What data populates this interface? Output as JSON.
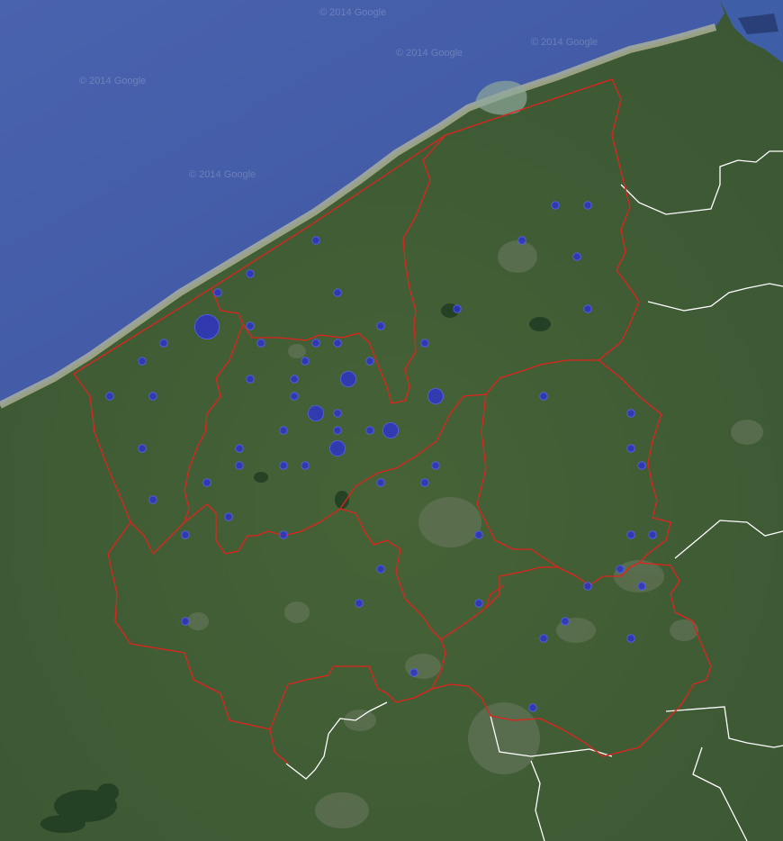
{
  "map": {
    "type": "satellite",
    "watermark_text": "© 2014 Google",
    "colors": {
      "sea": "#3f5aa6",
      "sea_deep": "#334c94",
      "land": "#3d5a36",
      "land_light": "#52703f",
      "coast": "#b3b49a",
      "region_border": "#e0231d",
      "national_border": "#ffffff",
      "marker_fill": "#2b2fd0",
      "marker_stroke": "#5560ff"
    },
    "markers": [
      {
        "id": "m1",
        "size": "large"
      },
      {
        "id": "m2",
        "size": "medium"
      },
      {
        "id": "m3",
        "size": "medium"
      },
      {
        "id": "m4",
        "size": "medium"
      },
      {
        "id": "m5",
        "size": "medium"
      },
      {
        "id": "m6",
        "size": "medium"
      },
      {
        "id": "m7",
        "size": "small"
      },
      {
        "id": "m8",
        "size": "small"
      },
      {
        "id": "m9",
        "size": "small"
      },
      {
        "id": "m10",
        "size": "small"
      },
      {
        "id": "m11",
        "size": "small"
      },
      {
        "id": "m12",
        "size": "small"
      },
      {
        "id": "m13",
        "size": "small"
      },
      {
        "id": "m14",
        "size": "small"
      },
      {
        "id": "m15",
        "size": "small"
      },
      {
        "id": "m16",
        "size": "small"
      },
      {
        "id": "m17",
        "size": "small"
      },
      {
        "id": "m18",
        "size": "small"
      },
      {
        "id": "m19",
        "size": "small"
      },
      {
        "id": "m20",
        "size": "small"
      },
      {
        "id": "m21",
        "size": "small"
      },
      {
        "id": "m22",
        "size": "small"
      },
      {
        "id": "m23",
        "size": "small"
      },
      {
        "id": "m24",
        "size": "small"
      },
      {
        "id": "m25",
        "size": "small"
      },
      {
        "id": "m26",
        "size": "small"
      },
      {
        "id": "m27",
        "size": "small"
      },
      {
        "id": "m28",
        "size": "small"
      },
      {
        "id": "m29",
        "size": "small"
      },
      {
        "id": "m30",
        "size": "small"
      },
      {
        "id": "m31",
        "size": "small"
      },
      {
        "id": "m32",
        "size": "small"
      },
      {
        "id": "m33",
        "size": "small"
      },
      {
        "id": "m34",
        "size": "small"
      },
      {
        "id": "m35",
        "size": "small"
      },
      {
        "id": "m36",
        "size": "small"
      },
      {
        "id": "m37",
        "size": "small"
      },
      {
        "id": "m38",
        "size": "small"
      },
      {
        "id": "m39",
        "size": "small"
      },
      {
        "id": "m40",
        "size": "small"
      },
      {
        "id": "m41",
        "size": "small"
      },
      {
        "id": "m42",
        "size": "small"
      },
      {
        "id": "m43",
        "size": "small"
      },
      {
        "id": "m44",
        "size": "small"
      },
      {
        "id": "m45",
        "size": "small"
      },
      {
        "id": "m46",
        "size": "small"
      },
      {
        "id": "m47",
        "size": "small"
      },
      {
        "id": "m48",
        "size": "small"
      },
      {
        "id": "m49",
        "size": "small"
      },
      {
        "id": "m50",
        "size": "small"
      },
      {
        "id": "m51",
        "size": "small"
      },
      {
        "id": "m52",
        "size": "small"
      },
      {
        "id": "m53",
        "size": "small"
      },
      {
        "id": "m54",
        "size": "small"
      },
      {
        "id": "m55",
        "size": "small"
      },
      {
        "id": "m56",
        "size": "small"
      },
      {
        "id": "m57",
        "size": "small"
      },
      {
        "id": "m58",
        "size": "small"
      },
      {
        "id": "m59",
        "size": "small"
      },
      {
        "id": "m60",
        "size": "small"
      },
      {
        "id": "m61",
        "size": "small"
      },
      {
        "id": "m62",
        "size": "small"
      }
    ]
  }
}
